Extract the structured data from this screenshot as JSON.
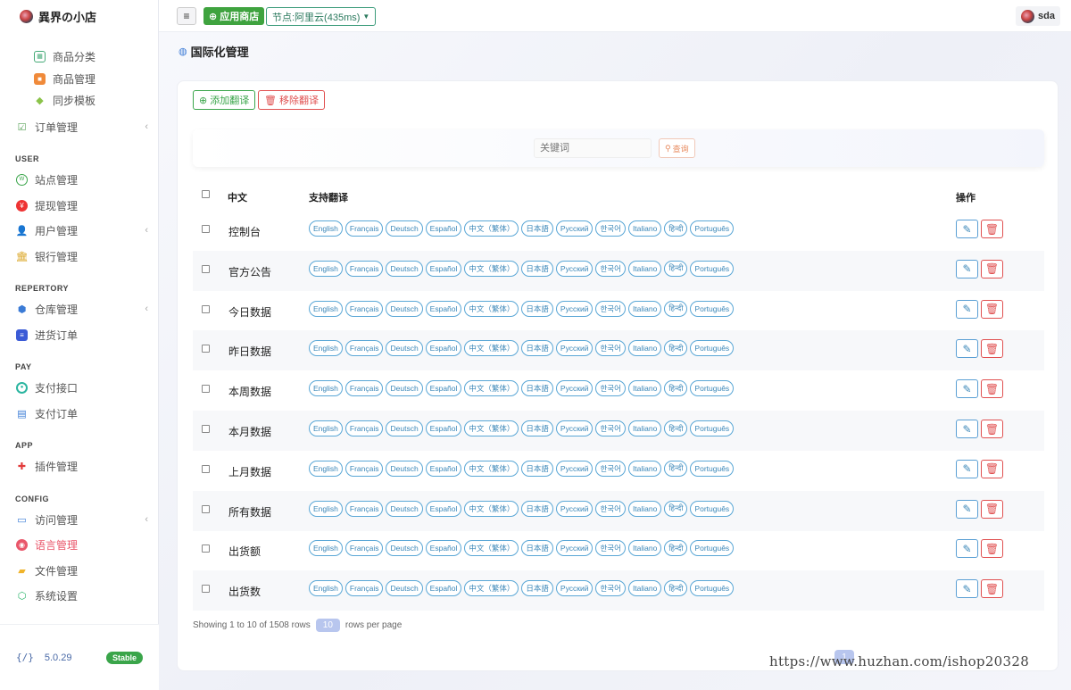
{
  "brand": {
    "name": "異界の小店"
  },
  "sidebar": {
    "items": [
      {
        "label": "商品分类",
        "icon": "grid-icon",
        "sub": true
      },
      {
        "label": "商品管理",
        "icon": "box-icon",
        "sub": true
      },
      {
        "label": "同步模板",
        "icon": "tag-icon",
        "sub": true
      },
      {
        "label": "订单管理",
        "icon": "order-icon",
        "expandable": true
      },
      {
        "label": "站点管理",
        "icon": "web-icon"
      },
      {
        "label": "提现管理",
        "icon": "withdraw-icon"
      },
      {
        "label": "用户管理",
        "icon": "users-icon",
        "expandable": true
      },
      {
        "label": "银行管理",
        "icon": "bank-icon"
      },
      {
        "label": "仓库管理",
        "icon": "warehouse-icon",
        "expandable": true
      },
      {
        "label": "进货订单",
        "icon": "purchase-icon"
      },
      {
        "label": "支付接口",
        "icon": "pay-api-icon"
      },
      {
        "label": "支付订单",
        "icon": "pay-order-icon"
      },
      {
        "label": "插件管理",
        "icon": "puzzle-icon"
      },
      {
        "label": "访问管理",
        "icon": "access-icon",
        "expandable": true
      },
      {
        "label": "语言管理",
        "icon": "language-icon",
        "active": true
      },
      {
        "label": "文件管理",
        "icon": "folder-icon"
      },
      {
        "label": "系统设置",
        "icon": "settings-icon"
      }
    ],
    "sections": [
      "USER",
      "REPERTORY",
      "PAY",
      "APP",
      "CONFIG"
    ],
    "version": "5.0.29",
    "version_badge": "Stable"
  },
  "topbar": {
    "menu_icon": "≡",
    "app_store": "应用商店",
    "node": "节点:阿里云(435ms)",
    "user": "sda"
  },
  "page": {
    "title": "国际化管理"
  },
  "toolbar": {
    "add": "添加翻译",
    "remove": "移除翻译"
  },
  "search": {
    "placeholder": "关键词",
    "button": "查询"
  },
  "table": {
    "headers": {
      "zh": "中文",
      "langs": "支持翻译",
      "actions": "操作"
    },
    "langs": [
      "English",
      "Français",
      "Deutsch",
      "Español",
      "中文（繁体）",
      "日本語",
      "Русский",
      "한국어",
      "Italiano",
      "हिन्दी",
      "Português"
    ],
    "rows": [
      "控制台",
      "官方公告",
      "今日数据",
      "昨日数据",
      "本周数据",
      "本月数据",
      "上月数据",
      "所有数据",
      "出货额",
      "出货数"
    ]
  },
  "footer": {
    "showing": "Showing 1 to 10 of 1508 rows",
    "per_page": "10",
    "per_page_label": "rows per page",
    "current_page": "1"
  },
  "watermark": "https://www.huzhan.com/ishop20328",
  "colors": {
    "accent_green": "#3fa33f",
    "active_red": "#e9566a",
    "tag_blue": "#3b87b8"
  }
}
